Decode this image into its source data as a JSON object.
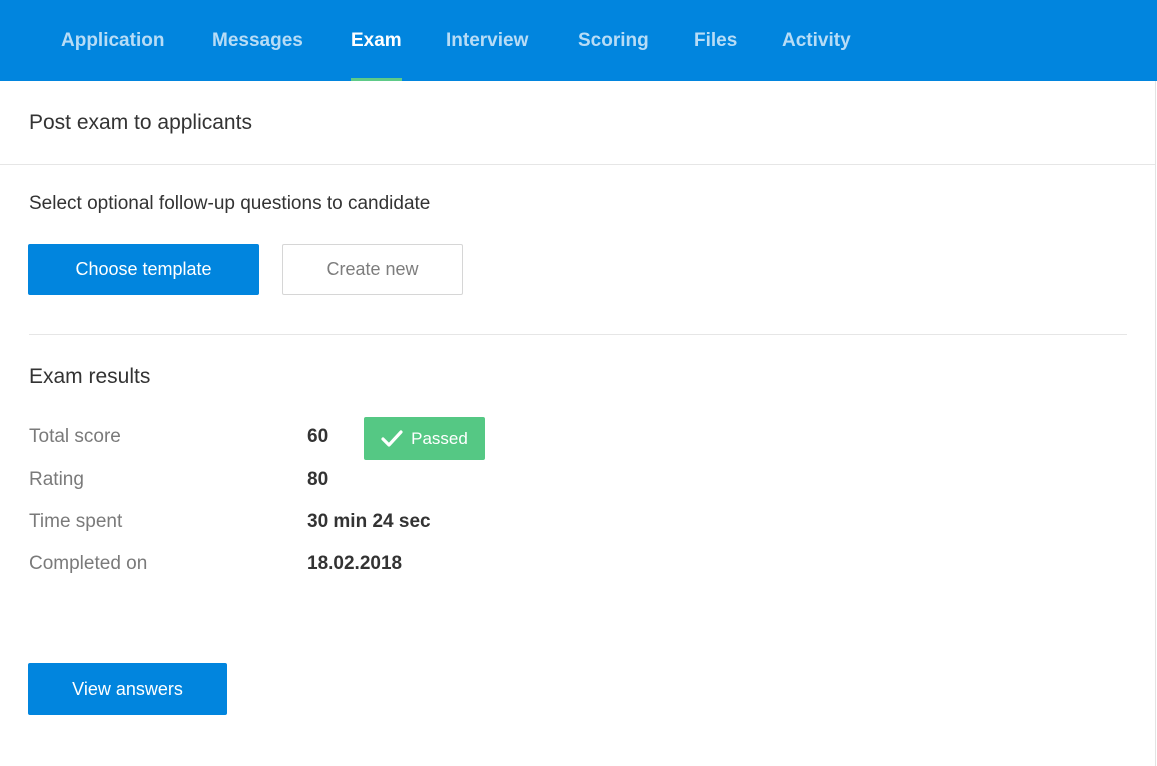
{
  "nav": {
    "tabs": [
      {
        "label": "Application"
      },
      {
        "label": "Messages"
      },
      {
        "label": "Exam"
      },
      {
        "label": "Interview"
      },
      {
        "label": "Scoring"
      },
      {
        "label": "Files"
      },
      {
        "label": "Activity"
      }
    ],
    "active_tab": "Exam"
  },
  "post_exam": {
    "title": "Post exam to applicants",
    "subtitle": "Select optional follow-up questions to candidate",
    "choose_template_label": "Choose template",
    "create_new_label": "Create new"
  },
  "results": {
    "title": "Exam results",
    "total_score": {
      "label": "Total score",
      "value": "60"
    },
    "status_badge": {
      "label": "Passed",
      "icon": "check-icon"
    },
    "rating": {
      "label": "Rating",
      "value": "80"
    },
    "time_spent": {
      "label": "Time spent",
      "value": "30 min 24 sec"
    },
    "completed_on": {
      "label": "Completed on",
      "value": "18.02.2018"
    },
    "view_answers_label": "View answers"
  },
  "colors": {
    "nav_background": "#0185de",
    "primary_button": "#0185de",
    "active_tab_underline": "#5ecb88",
    "passed_badge": "#55c884"
  }
}
